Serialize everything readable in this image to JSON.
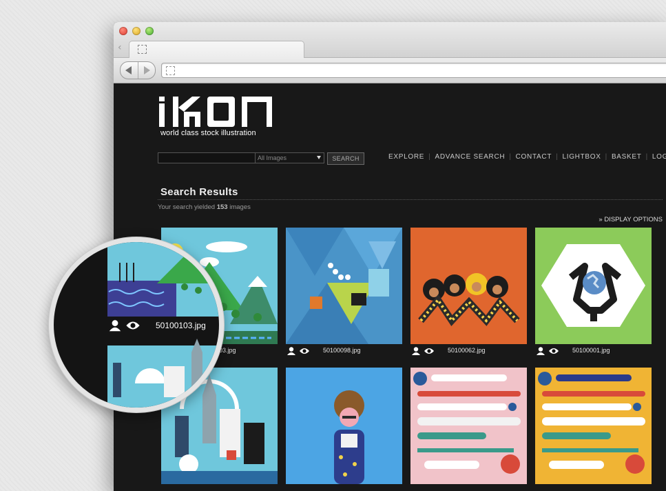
{
  "site": {
    "logo_text": "iKON",
    "tagline": "world class stock illustration"
  },
  "search": {
    "input_value": "",
    "select_value": "All Images",
    "button_label": "SEARCH"
  },
  "nav": {
    "items": [
      {
        "label": "EXPLORE"
      },
      {
        "label": "ADVANCE SEARCH"
      },
      {
        "label": "CONTACT"
      },
      {
        "label": "LIGHTBOX"
      },
      {
        "label": "BASKET"
      },
      {
        "label": "LOG IN"
      }
    ]
  },
  "results": {
    "title": "Search Results",
    "yield_prefix": "Your search yielded",
    "count": "153",
    "yield_suffix": "images",
    "display_options": "» DISPLAY OPTIONS"
  },
  "grid": {
    "row1": [
      {
        "filename": "50100103.jpg",
        "color": "#6fc7dc",
        "icon": "landscape-illustration"
      },
      {
        "filename": "50100098.jpg",
        "color": "#4a94c8",
        "icon": "geometric-illustration"
      },
      {
        "filename": "50100062.jpg",
        "color": "#e0662e",
        "icon": "people-illustration"
      },
      {
        "filename": "50100001.jpg",
        "color": "#8ccb5a",
        "icon": "globe-hexagon-illustration"
      }
    ],
    "row2": [
      {
        "filename": "",
        "color": "#6fc7dc",
        "icon": "city-illustration"
      },
      {
        "filename": "",
        "color": "#4ca5e4",
        "icon": "woman-illustration"
      },
      {
        "filename": "",
        "color": "#f1c3c9",
        "icon": "medical-tools-illustration"
      },
      {
        "filename": "",
        "color": "#f0b434",
        "icon": "medical-tools-illustration"
      }
    ]
  },
  "magnifier": {
    "filename": "50100103.jpg"
  }
}
